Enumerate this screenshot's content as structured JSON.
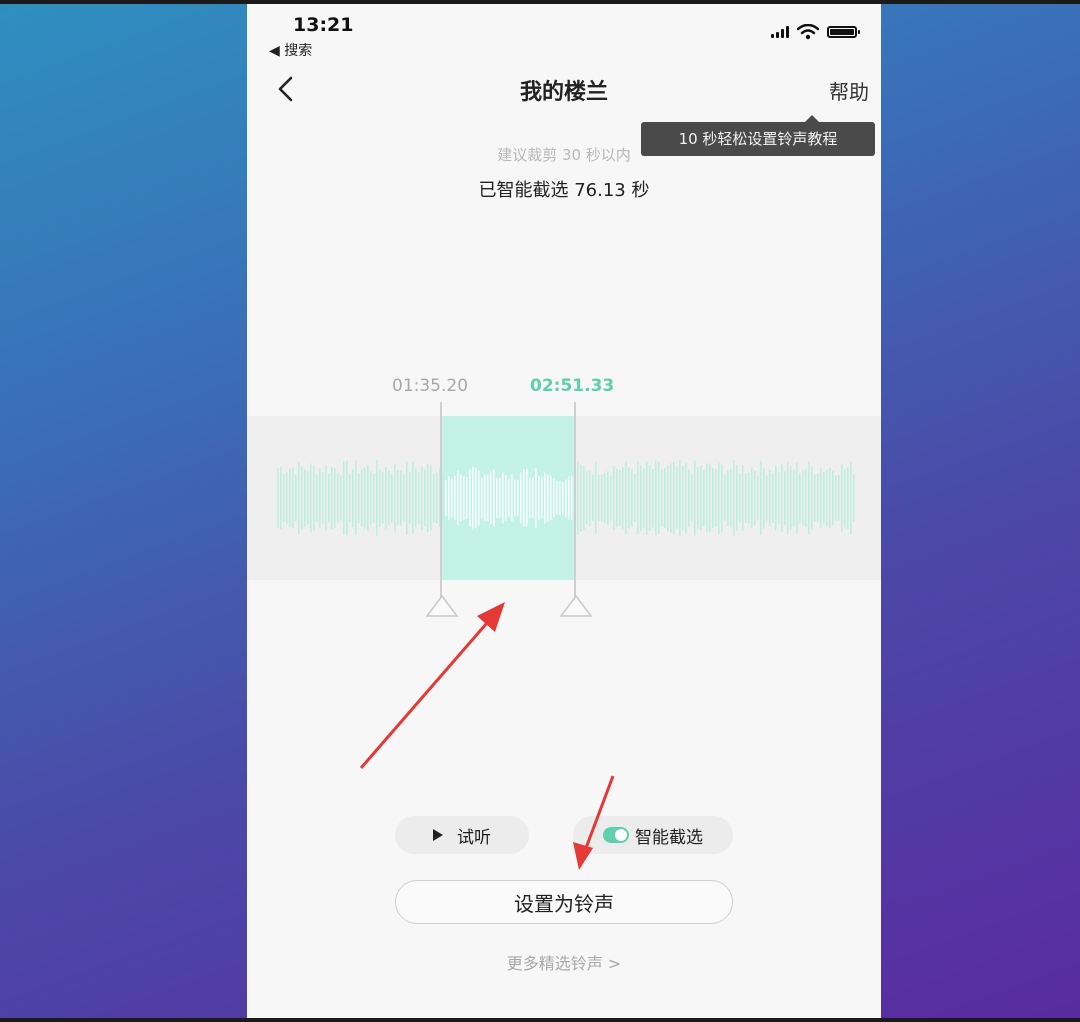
{
  "status": {
    "time": "13:21",
    "back_app": "◀ 搜索"
  },
  "nav": {
    "title": "我的楼兰",
    "help": "帮助"
  },
  "tooltip": "10 秒轻松设置铃声教程",
  "hint": "建议裁剪 30 秒以内",
  "selected_info": "已智能截选 76.13 秒",
  "selection": {
    "start_time": "01:35.20",
    "end_time": "02:51.33"
  },
  "controls": {
    "play_label": "试听",
    "smart_label": "智能截选",
    "smart_enabled": true
  },
  "set_button": "设置为铃声",
  "more_link": "更多精选铃声 >",
  "colors": {
    "accent": "#5fcfae",
    "selection": "#c4f2e6",
    "wave": "#bfeede",
    "arrow": "#e53935"
  },
  "icons": {
    "back": "chevron-left-icon",
    "play": "play-icon",
    "toggle": "toggle-on-icon",
    "signal": "signal-icon",
    "wifi": "wifi-icon",
    "battery": "battery-icon"
  }
}
